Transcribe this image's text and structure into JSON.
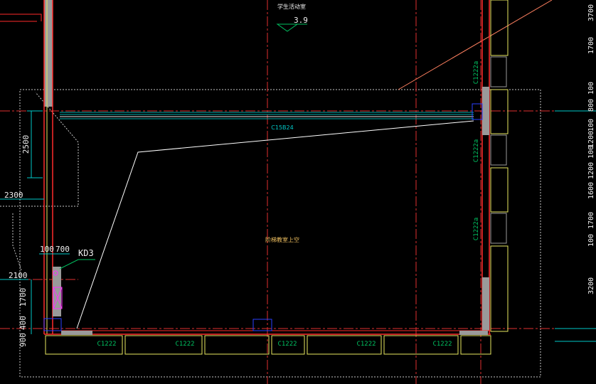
{
  "drawing": {
    "elevation": "3.9",
    "room_label_top": "学生活动室",
    "room_label_center": "阶梯教室上空",
    "beam_label": "C15B24",
    "opening_label": "KD3",
    "windows_bottom": [
      "C1222",
      "C1222",
      "C1222",
      "C1222",
      "C1222"
    ],
    "windows_right": [
      "C1222a",
      "C1222a",
      "C1222a"
    ],
    "dims_left": {
      "d2500": "2500",
      "d2300": "2300",
      "d100": "100",
      "d700": "700",
      "d2100": "2100",
      "d1700": "1700",
      "d900": "900",
      "d400": "400"
    },
    "dims_right": [
      "3700",
      "1700",
      "100",
      "800",
      "100",
      "1200",
      "100",
      "1200",
      "1600",
      "1700",
      "100",
      "3200"
    ]
  },
  "colors": {
    "background": "#000000",
    "wall": "#ff2a2a",
    "axis": "#e03030",
    "dimension": "#00c8c8",
    "window": "#e8e860",
    "beam": "#00b0b0",
    "annotation": "#00c060",
    "cloud": "#c8c8c8",
    "column": "#9a9a9a",
    "marker": "#ff30ff"
  }
}
